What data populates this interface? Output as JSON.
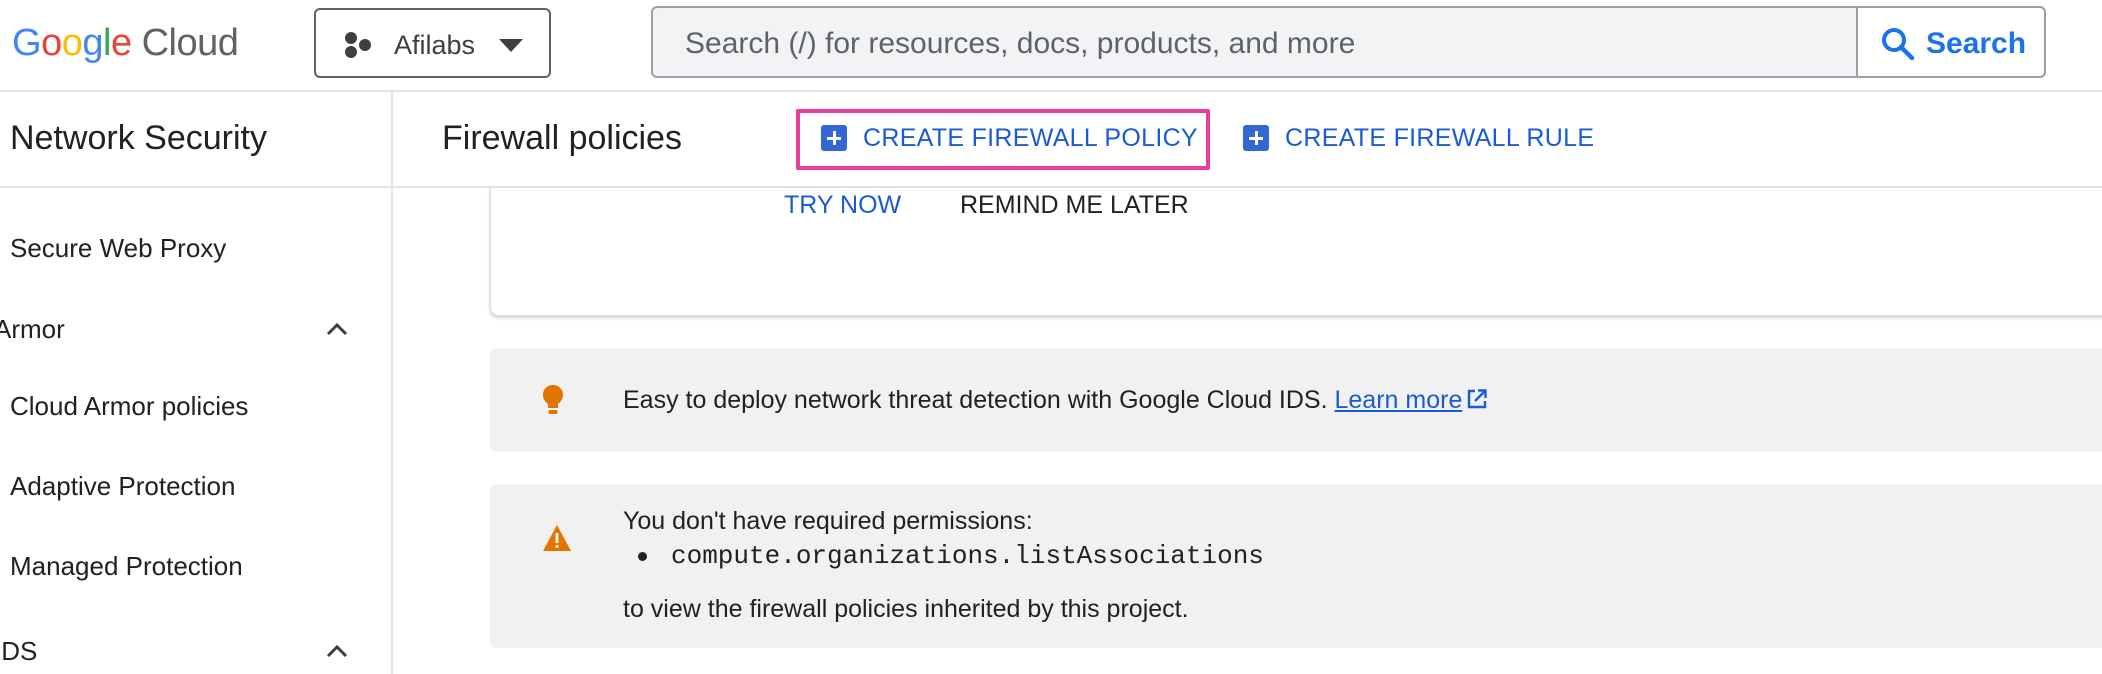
{
  "topbar": {
    "logo_google": [
      "G",
      "o",
      "o",
      "g",
      "l",
      "e"
    ],
    "logo_cloud": "Cloud",
    "project_name": "Afilabs",
    "search_placeholder": "Search (/) for resources, docs, products, and more",
    "search_button": "Search"
  },
  "sidebar": {
    "title": "Network Security",
    "items": [
      {
        "label": "Secure Web Proxy",
        "type": "item"
      },
      {
        "label": "Armor",
        "type": "group",
        "expanded": true
      },
      {
        "label": "Cloud Armor policies",
        "type": "item"
      },
      {
        "label": "Adaptive Protection",
        "type": "item"
      },
      {
        "label": "Managed Protection",
        "type": "item"
      },
      {
        "label": "IDS",
        "type": "group",
        "expanded": true
      }
    ]
  },
  "header": {
    "title": "Firewall policies",
    "actions": {
      "create_policy": "CREATE FIREWALL POLICY",
      "create_rule": "CREATE FIREWALL RULE"
    }
  },
  "promo": {
    "try_now": "TRY NOW",
    "remind_later": "REMIND ME LATER"
  },
  "ids_banner": {
    "icon": "lightbulb-icon",
    "text": "Easy to deploy network threat detection with Google Cloud IDS. ",
    "link": "Learn more"
  },
  "permission_banner": {
    "icon": "warning-icon",
    "line1": "You don't have required permissions:",
    "permission": "compute.organizations.listAssociations",
    "line3": "to view the firewall policies inherited by this project."
  },
  "colors": {
    "accent": "#1a73e8",
    "link": "#1a5bd4",
    "highlight": "#e53e9a",
    "warning": "#e37400",
    "bulb": "#e37400"
  }
}
